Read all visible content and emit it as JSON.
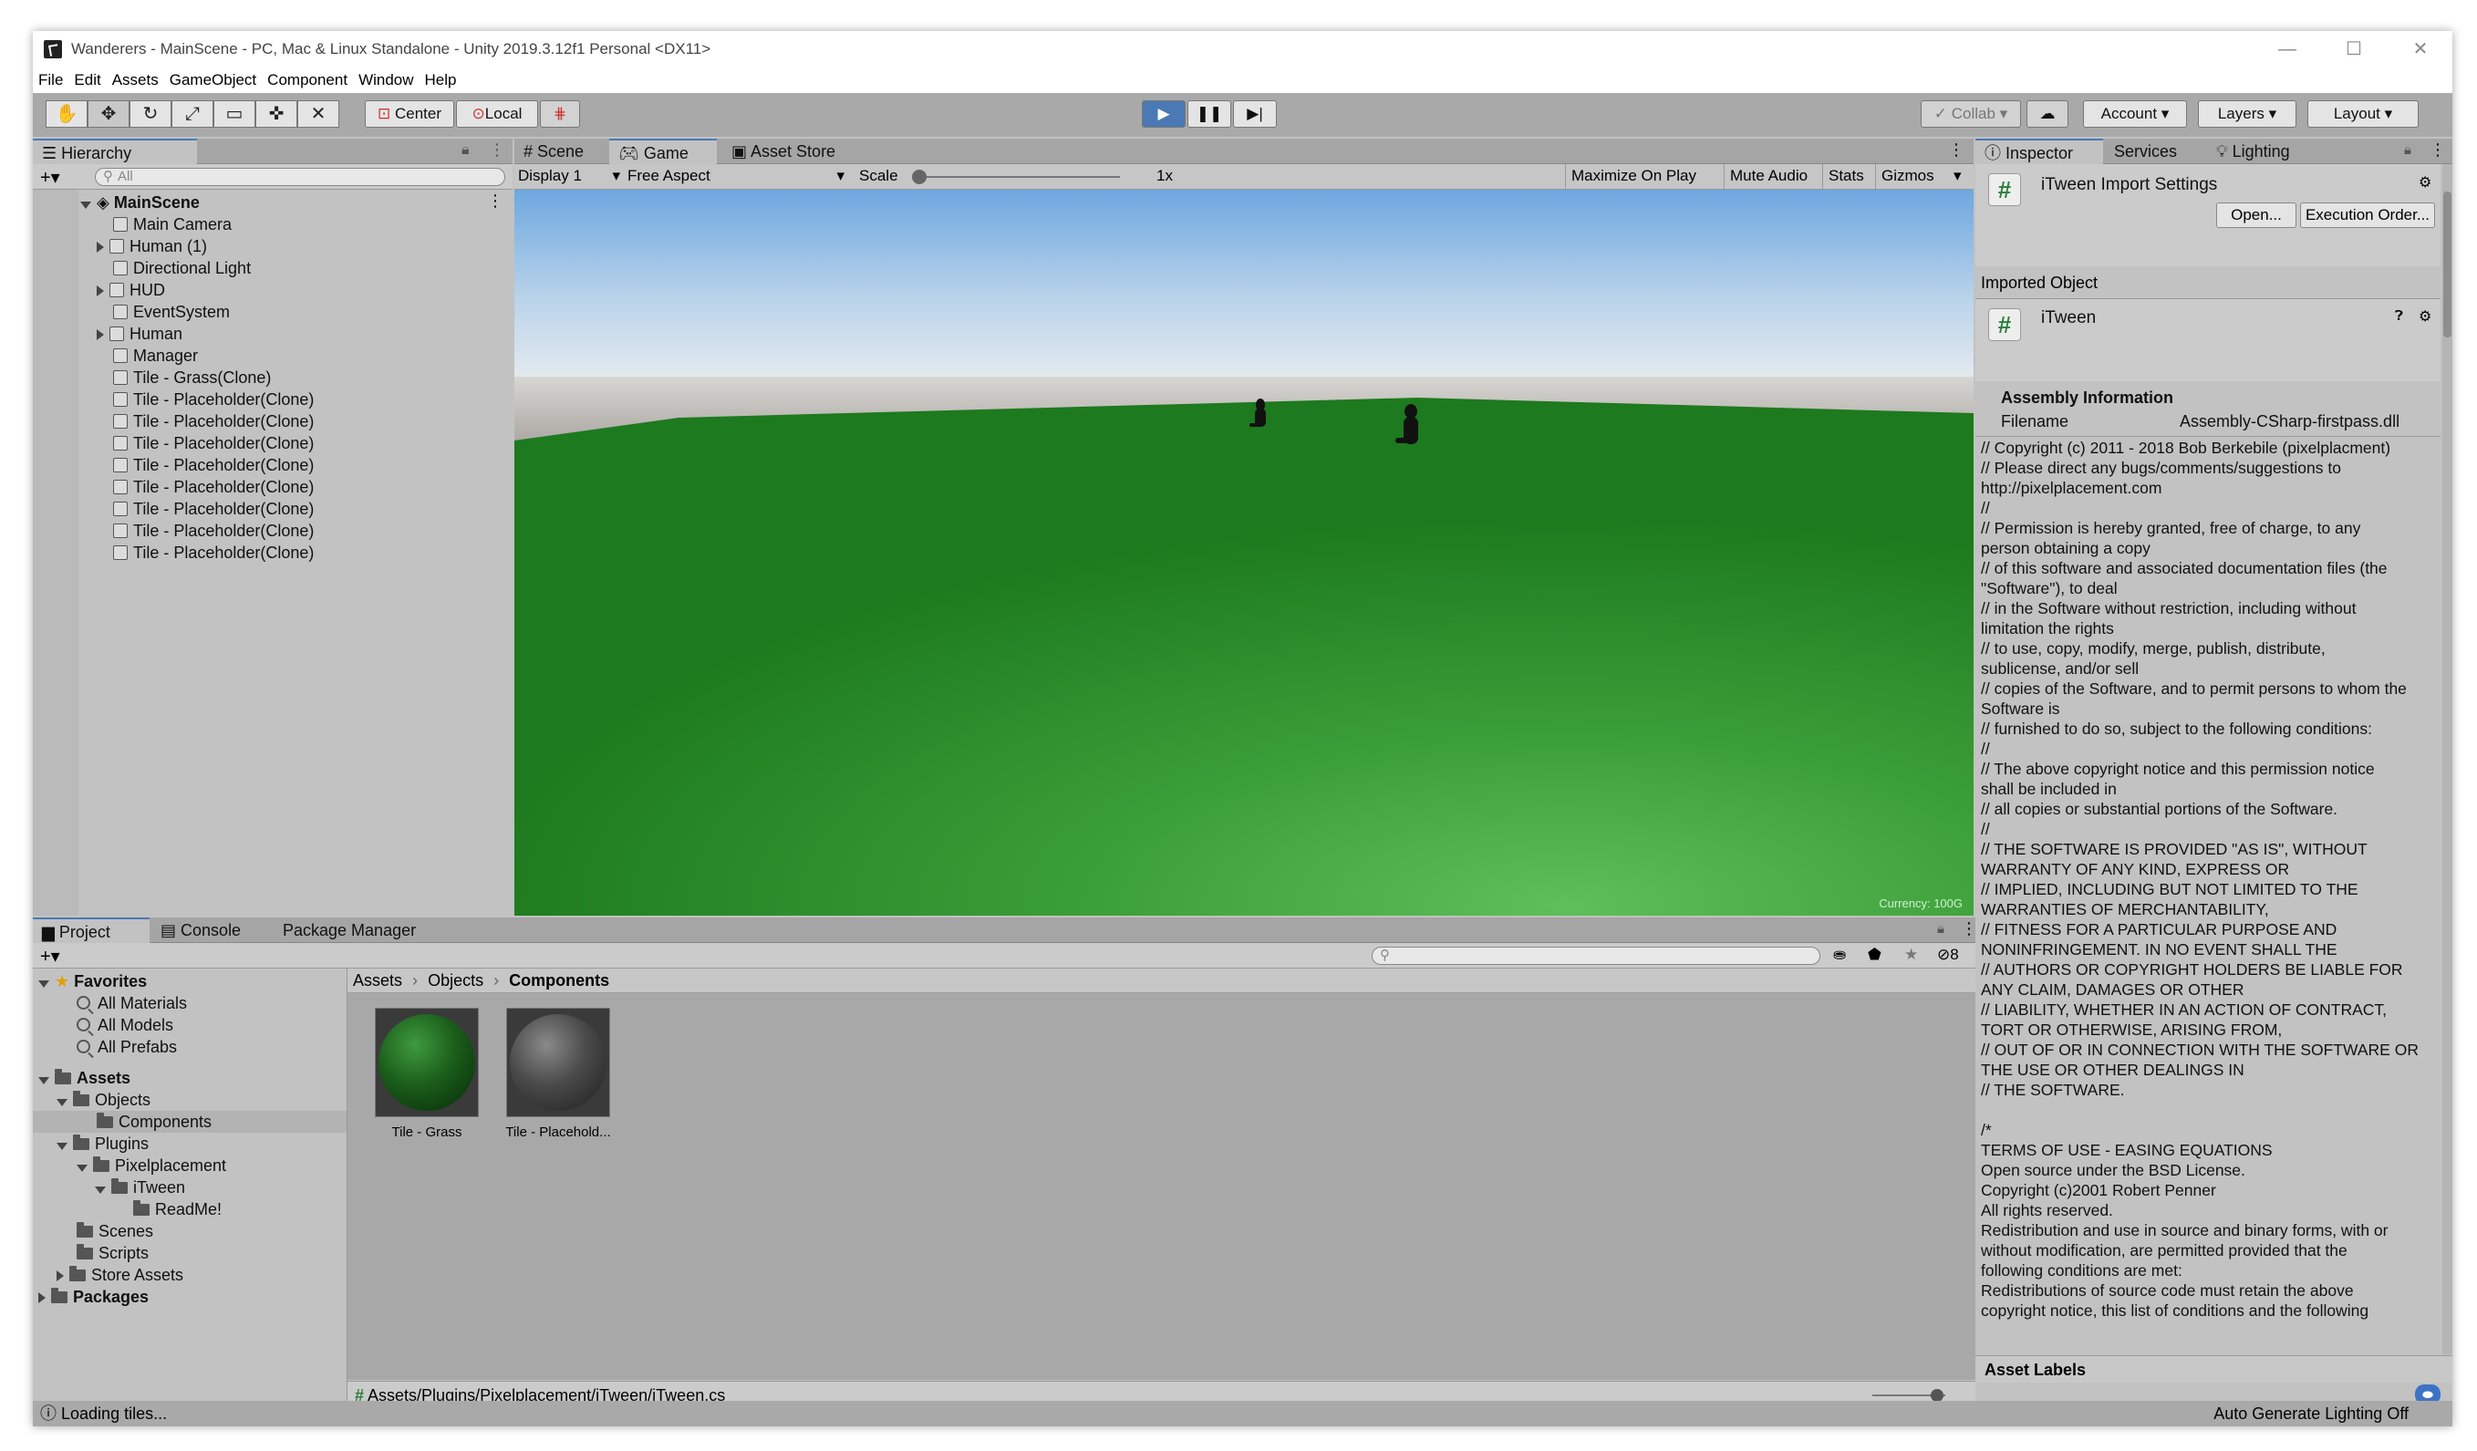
{
  "window": {
    "title": "Wanderers - MainScene - PC, Mac & Linux Standalone - Unity 2019.3.12f1 Personal <DX11>"
  },
  "menu": [
    "File",
    "Edit",
    "Assets",
    "GameObject",
    "Component",
    "Window",
    "Help"
  ],
  "toolbar": {
    "pivot": "Center",
    "space": "Local",
    "collab": "Collab",
    "account": "Account",
    "layers": "Layers",
    "layout": "Layout"
  },
  "hierarchy": {
    "tab": "Hierarchy",
    "search_placeholder": "All",
    "scene": "MainScene",
    "items": [
      {
        "label": "Main Camera",
        "arrow": false
      },
      {
        "label": "Human (1)",
        "arrow": true
      },
      {
        "label": "Directional Light",
        "arrow": false
      },
      {
        "label": "HUD",
        "arrow": true
      },
      {
        "label": "EventSystem",
        "arrow": false
      },
      {
        "label": "Human",
        "arrow": true
      },
      {
        "label": "Manager",
        "arrow": false
      },
      {
        "label": "Tile - Grass(Clone)",
        "arrow": false
      },
      {
        "label": "Tile - Placeholder(Clone)",
        "arrow": false
      },
      {
        "label": "Tile - Placeholder(Clone)",
        "arrow": false
      },
      {
        "label": "Tile - Placeholder(Clone)",
        "arrow": false
      },
      {
        "label": "Tile - Placeholder(Clone)",
        "arrow": false
      },
      {
        "label": "Tile - Placeholder(Clone)",
        "arrow": false
      },
      {
        "label": "Tile - Placeholder(Clone)",
        "arrow": false
      },
      {
        "label": "Tile - Placeholder(Clone)",
        "arrow": false
      },
      {
        "label": "Tile - Placeholder(Clone)",
        "arrow": false
      }
    ]
  },
  "game": {
    "tabs": [
      "Scene",
      "Game",
      "Asset Store"
    ],
    "display": "Display 1",
    "aspect": "Free Aspect",
    "scale_label": "Scale",
    "scale_value": "1x",
    "buttons": [
      "Maximize On Play",
      "Mute Audio",
      "Stats",
      "Gizmos"
    ],
    "currency": "Currency: 100G"
  },
  "project": {
    "tabs": [
      "Project",
      "Console",
      "Package Manager"
    ],
    "favorites": {
      "label": "Favorites",
      "items": [
        "All Materials",
        "All Models",
        "All Prefabs"
      ]
    },
    "tree": {
      "assets": "Assets",
      "objects": "Objects",
      "components": "Components",
      "plugins": "Plugins",
      "pixelplacement": "Pixelplacement",
      "itween": "iTween",
      "readme": "ReadMe!",
      "scenes": "Scenes",
      "scripts": "Scripts",
      "store_assets": "Store Assets",
      "packages": "Packages"
    },
    "breadcrumb": [
      "Assets",
      "Objects",
      "Components"
    ],
    "assets": [
      {
        "label": "Tile - Grass",
        "color": "#1f6b1f"
      },
      {
        "label": "Tile - Placehold...",
        "color": "#5a5a5a"
      }
    ],
    "hidden_count": "8",
    "path": "Assets/Plugins/Pixelplacement/iTween/iTween.cs"
  },
  "inspector": {
    "tabs": [
      "Inspector",
      "Services",
      "Lighting"
    ],
    "title": "iTween Import Settings",
    "open": "Open...",
    "execution_order": "Execution Order...",
    "imported_object": "Imported Object",
    "object_name": "iTween",
    "assembly_header": "Assembly Information",
    "filename_label": "Filename",
    "filename_value": "Assembly-CSharp-firstpass.dll",
    "license_text": "// Copyright (c) 2011 - 2018 Bob Berkebile (pixelplacment)\n// Please direct any bugs/comments/suggestions to\nhttp://pixelplacement.com\n//\n// Permission is hereby granted, free of charge, to any\nperson obtaining a copy\n// of this software and associated documentation files (the\n\"Software\"), to deal\n// in the Software without restriction, including without\nlimitation the rights\n// to use, copy, modify, merge, publish, distribute,\nsublicense, and/or sell\n// copies of the Software, and to permit persons to whom the\nSoftware is\n// furnished to do so, subject to the following conditions:\n//\n// The above copyright notice and this permission notice\nshall be included in\n// all copies or substantial portions of the Software.\n//\n// THE SOFTWARE IS PROVIDED \"AS IS\", WITHOUT\nWARRANTY OF ANY KIND, EXPRESS OR\n// IMPLIED, INCLUDING BUT NOT LIMITED TO THE\nWARRANTIES OF MERCHANTABILITY,\n// FITNESS FOR A PARTICULAR PURPOSE AND\nNONINFRINGEMENT. IN NO EVENT SHALL THE\n// AUTHORS OR COPYRIGHT HOLDERS BE LIABLE FOR\nANY CLAIM, DAMAGES OR OTHER\n// LIABILITY, WHETHER IN AN ACTION OF CONTRACT,\nTORT OR OTHERWISE, ARISING FROM,\n// OUT OF OR IN CONNECTION WITH THE SOFTWARE OR\nTHE USE OR OTHER DEALINGS IN\n// THE SOFTWARE.\n\n/*\nTERMS OF USE - EASING EQUATIONS\nOpen source under the BSD License.\nCopyright (c)2001 Robert Penner\nAll rights reserved.\nRedistribution and use in source and binary forms, with or\nwithout modification, are permitted provided that the\nfollowing conditions are met:\nRedistributions of source code must retain the above\ncopyright notice, this list of conditions and the following",
    "asset_labels": "Asset Labels"
  },
  "status": {
    "left": "Loading tiles...",
    "right": "Auto Generate Lighting Off"
  },
  "colors": {
    "accent": "#4a79b5",
    "grass": "#2a8a2a",
    "sky": "#7fb1e3"
  }
}
